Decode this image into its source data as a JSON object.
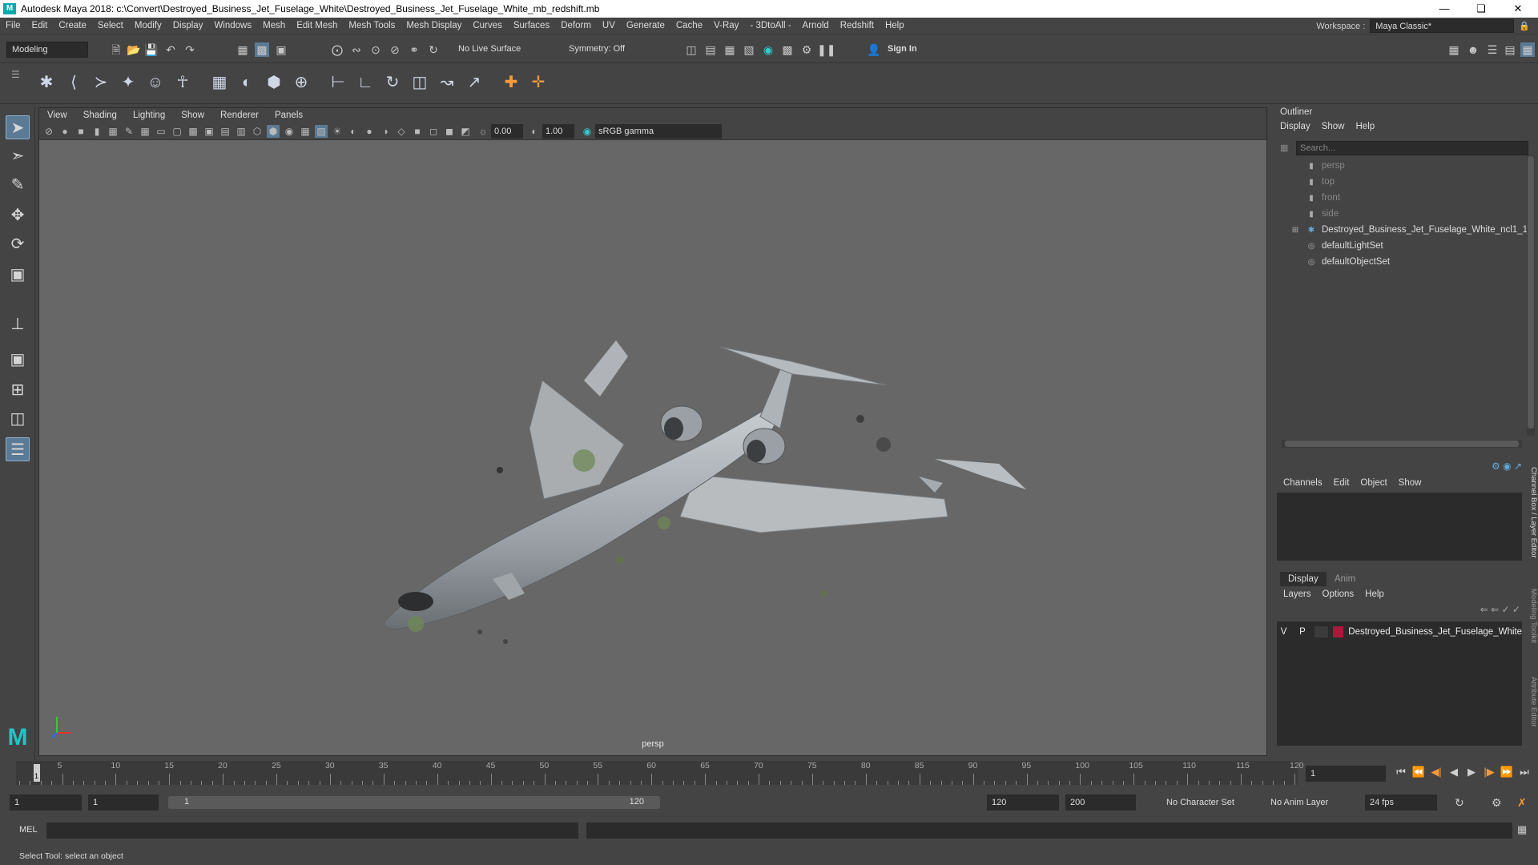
{
  "window": {
    "title": "Autodesk Maya 2018: c:\\Convert\\Destroyed_Business_Jet_Fuselage_White\\Destroyed_Business_Jet_Fuselage_White_mb_redshift.mb"
  },
  "menubar": [
    "File",
    "Edit",
    "Create",
    "Select",
    "Modify",
    "Display",
    "Windows",
    "Mesh",
    "Edit Mesh",
    "Mesh Tools",
    "Mesh Display",
    "Curves",
    "Surfaces",
    "Deform",
    "UV",
    "Generate",
    "Cache",
    "V-Ray",
    "- 3DtoAll -",
    "Arnold",
    "Redshift",
    "Help"
  ],
  "workspace": {
    "label": "Workspace :",
    "value": "Maya Classic*"
  },
  "statusline": {
    "mode": "Modeling",
    "live_surface": "No Live Surface",
    "symmetry": "Symmetry: Off",
    "sign_in": "Sign In"
  },
  "viewport": {
    "menu": [
      "View",
      "Shading",
      "Lighting",
      "Show",
      "Renderer",
      "Panels"
    ],
    "exposure": "0.00",
    "gamma": "1.00",
    "color_space": "sRGB gamma",
    "camera": "persp"
  },
  "outliner": {
    "title": "Outliner",
    "menu": [
      "Display",
      "Show",
      "Help"
    ],
    "search_placeholder": "Search...",
    "items": [
      {
        "label": "persp",
        "kind": "camera"
      },
      {
        "label": "top",
        "kind": "camera"
      },
      {
        "label": "front",
        "kind": "camera"
      },
      {
        "label": "side",
        "kind": "camera"
      },
      {
        "label": "Destroyed_Business_Jet_Fuselage_White_ncl1_1",
        "kind": "group"
      },
      {
        "label": "defaultLightSet",
        "kind": "set"
      },
      {
        "label": "defaultObjectSet",
        "kind": "set"
      }
    ]
  },
  "channelbox": {
    "menu": [
      "Channels",
      "Edit",
      "Object",
      "Show"
    ]
  },
  "layers": {
    "tabs": [
      "Display",
      "Anim"
    ],
    "menu": [
      "Layers",
      "Options",
      "Help"
    ],
    "row": {
      "v": "V",
      "p": "P",
      "name": "Destroyed_Business_Jet_Fuselage_White",
      "color": "#b0163a"
    }
  },
  "side_tabs": [
    "Channel Box / Layer Editor",
    "Modeling Toolkit",
    "Attribute Editor"
  ],
  "timeline": {
    "ticks": [
      "5",
      "10",
      "15",
      "20",
      "25",
      "30",
      "35",
      "40",
      "45",
      "50",
      "55",
      "60",
      "65",
      "70",
      "75",
      "80",
      "85",
      "90",
      "95",
      "100",
      "105",
      "110",
      "115",
      "120"
    ],
    "current_frame": "1",
    "current_frame_field": "1"
  },
  "range": {
    "start": "1",
    "playback_start": "1",
    "slider_start": "1",
    "slider_end": "120",
    "playback_end": "120",
    "end": "200",
    "character_set": "No Character Set",
    "anim_layer": "No Anim Layer",
    "fps": "24 fps"
  },
  "command": {
    "label": "MEL"
  },
  "help_line": "Select Tool: select an object"
}
